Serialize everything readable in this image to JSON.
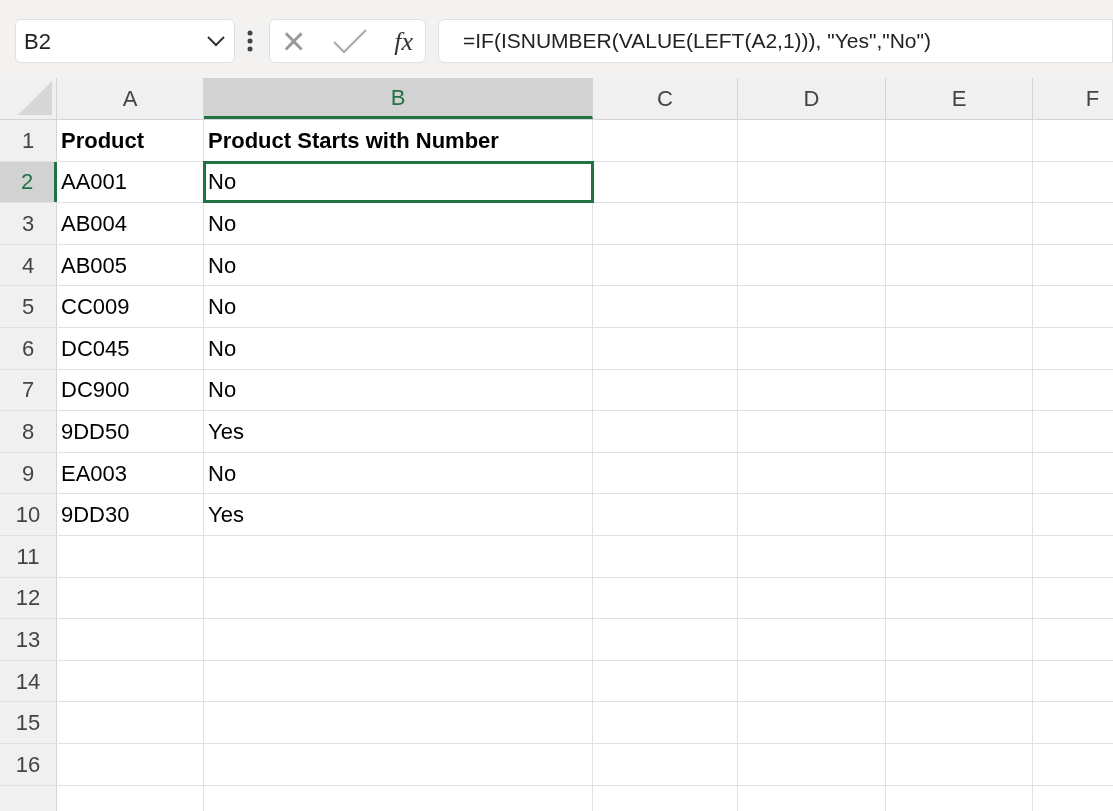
{
  "name_box": {
    "value": "B2"
  },
  "formula_bar": {
    "cancel_symbol": "×",
    "fx_label": "fx",
    "value": "=IF(ISNUMBER(VALUE(LEFT(A2,1))), \"Yes\",\"No\")"
  },
  "columns": [
    {
      "label": "A",
      "selected": false
    },
    {
      "label": "B",
      "selected": true
    },
    {
      "label": "C",
      "selected": false
    },
    {
      "label": "D",
      "selected": false
    },
    {
      "label": "E",
      "selected": false
    },
    {
      "label": "F",
      "selected": false
    }
  ],
  "rows": [
    {
      "number": "1",
      "selected": false,
      "cells": [
        {
          "text": "Product",
          "bold": true,
          "selected": false
        },
        {
          "text": "Product Starts with Number",
          "bold": true,
          "selected": false
        }
      ]
    },
    {
      "number": "2",
      "selected": true,
      "cells": [
        {
          "text": "AA001",
          "bold": false,
          "selected": false
        },
        {
          "text": "No",
          "bold": false,
          "selected": true
        }
      ]
    },
    {
      "number": "3",
      "selected": false,
      "cells": [
        {
          "text": "AB004",
          "bold": false,
          "selected": false
        },
        {
          "text": "No",
          "bold": false,
          "selected": false
        }
      ]
    },
    {
      "number": "4",
      "selected": false,
      "cells": [
        {
          "text": "AB005",
          "bold": false,
          "selected": false
        },
        {
          "text": "No",
          "bold": false,
          "selected": false
        }
      ]
    },
    {
      "number": "5",
      "selected": false,
      "cells": [
        {
          "text": "CC009",
          "bold": false,
          "selected": false
        },
        {
          "text": "No",
          "bold": false,
          "selected": false
        }
      ]
    },
    {
      "number": "6",
      "selected": false,
      "cells": [
        {
          "text": "DC045",
          "bold": false,
          "selected": false
        },
        {
          "text": "No",
          "bold": false,
          "selected": false
        }
      ]
    },
    {
      "number": "7",
      "selected": false,
      "cells": [
        {
          "text": "DC900",
          "bold": false,
          "selected": false
        },
        {
          "text": "No",
          "bold": false,
          "selected": false
        }
      ]
    },
    {
      "number": "8",
      "selected": false,
      "cells": [
        {
          "text": "9DD50",
          "bold": false,
          "selected": false
        },
        {
          "text": "Yes",
          "bold": false,
          "selected": false
        }
      ]
    },
    {
      "number": "9",
      "selected": false,
      "cells": [
        {
          "text": "EA003",
          "bold": false,
          "selected": false
        },
        {
          "text": "No",
          "bold": false,
          "selected": false
        }
      ]
    },
    {
      "number": "10",
      "selected": false,
      "cells": [
        {
          "text": "9DD30",
          "bold": false,
          "selected": false
        },
        {
          "text": "Yes",
          "bold": false,
          "selected": false
        }
      ]
    },
    {
      "number": "11",
      "selected": false
    },
    {
      "number": "12",
      "selected": false
    },
    {
      "number": "13",
      "selected": false
    },
    {
      "number": "14",
      "selected": false
    },
    {
      "number": "15",
      "selected": false
    },
    {
      "number": "16",
      "selected": false
    }
  ]
}
